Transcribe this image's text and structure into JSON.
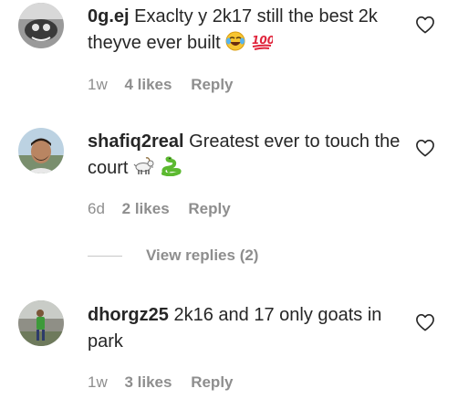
{
  "comments": [
    {
      "username": "0g.ej",
      "text": "Exaclty y 2k17 still the best 2k theyve ever built",
      "emojis": [
        "face-with-tears-of-joy-icon",
        "hundred-points-icon"
      ],
      "time": "1w",
      "likes": "4 likes",
      "reply_label": "Reply"
    },
    {
      "username": "shafiq2real",
      "text": "Greatest ever to touch the court",
      "emojis": [
        "goat-icon",
        "snake-icon"
      ],
      "time": "6d",
      "likes": "2 likes",
      "reply_label": "Reply",
      "view_replies": "View replies (2)"
    },
    {
      "username": "dhorgz25",
      "text": "2k16 and 17 only goats in park",
      "emojis": [],
      "time": "1w",
      "likes": "3 likes",
      "reply_label": "Reply"
    }
  ],
  "colors": {
    "text": "#262626",
    "secondary": "#8e8e8e",
    "divider": "#c7c7c7"
  }
}
